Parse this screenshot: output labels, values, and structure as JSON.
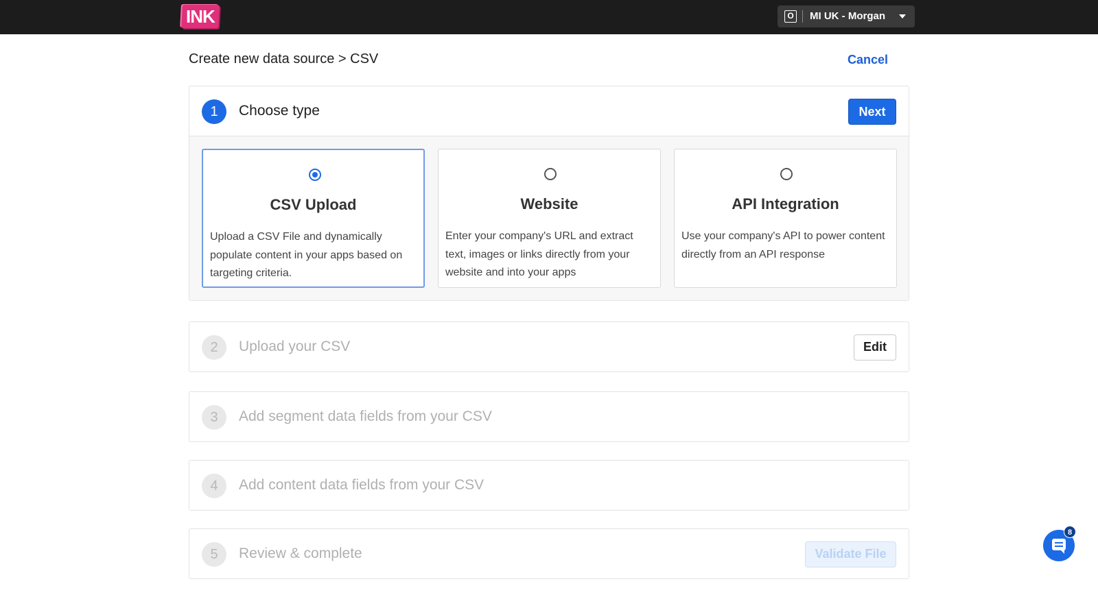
{
  "topbar": {
    "logo_text": "INK",
    "account": {
      "icon_letter": "O",
      "name": "MI UK - Morgan"
    }
  },
  "header": {
    "breadcrumb": "Create new data source > CSV",
    "cancel_label": "Cancel"
  },
  "steps": [
    {
      "number": "1",
      "title": "Choose type",
      "action_label": "Next"
    },
    {
      "number": "2",
      "title": "Upload your CSV",
      "action_label": "Edit"
    },
    {
      "number": "3",
      "title": "Add segment data fields from your CSV"
    },
    {
      "number": "4",
      "title": "Add content data fields from your CSV"
    },
    {
      "number": "5",
      "title": "Review & complete",
      "action_label": "Validate File"
    }
  ],
  "options": [
    {
      "title": "CSV Upload",
      "description": "Upload a CSV File and dynamically populate content in your apps based on targeting criteria.",
      "selected": true
    },
    {
      "title": "Website",
      "description": "Enter your company's URL and extract text, images or links directly from your website and into your apps",
      "selected": false
    },
    {
      "title": "API Integration",
      "description": "Use your company's API to power content directly from an API response",
      "selected": false
    }
  ],
  "chat": {
    "badge_count": "8"
  },
  "colors": {
    "accent": "#1d6ae5",
    "topbar": "#1c1c1c",
    "logo": "#e0307a"
  }
}
